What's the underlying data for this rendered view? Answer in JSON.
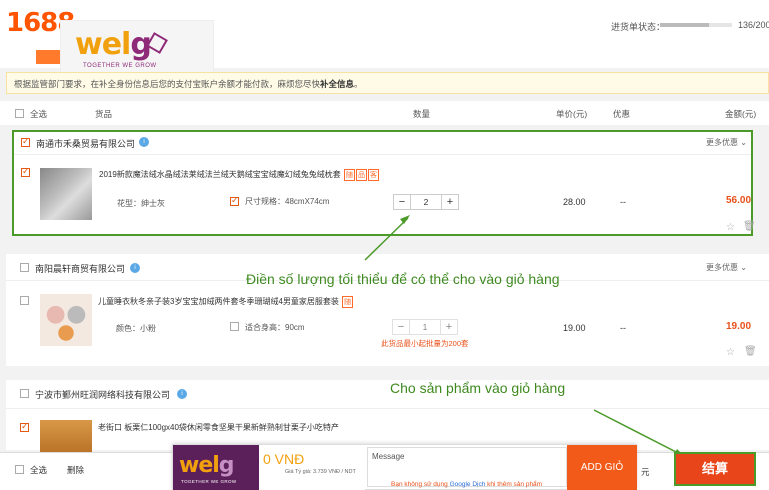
{
  "topbar": {
    "site_number": "1688",
    "status_label": "进货单状态：",
    "status_count": "136/200",
    "status_progress": 0.68
  },
  "logo": {
    "word_left": "wel",
    "word_right": "g",
    "tagline": "TOGETHER WE GROW"
  },
  "notice": {
    "text": "根据监管部门要求，在补全身份信息后您的支付宝账户余额才能付款，麻烦您尽快",
    "bold": "补全信息",
    "end": "。"
  },
  "header": {
    "select_all": "全选",
    "columns": {
      "goods": "货品",
      "quantity": "数量",
      "unit_price": "单价(元)",
      "discount": "优惠",
      "amount": "金额(元)"
    }
  },
  "shops": [
    {
      "name": "南通市禾桑贸易有限公司",
      "more": "更多优惠",
      "checked": true,
      "product": {
        "name": "2019新款魔法绒水晶绒法莱绒法兰绒天鹅绒宝宝绒魔幻绒兔兔绒枕套",
        "badges": [
          "随",
          "品",
          "客"
        ],
        "variant_label": "花型：",
        "variant_value": "绅士灰",
        "size_label": "尺寸规格：",
        "size_value": "48cmX74cm",
        "quantity": "2",
        "unit_price": "28.00",
        "discount": "--",
        "amount": "56.00"
      }
    },
    {
      "name": "南阳晨轩商贸有限公司",
      "more": "更多优惠",
      "checked": false,
      "product": {
        "name": "儿童睡衣秋冬亲子装3岁宝宝加绒两件套冬季珊瑚绒4男童家居服套装",
        "badges": [
          "随"
        ],
        "variant_label": "颜色：",
        "variant_value": "小粉",
        "size_label": "适合身高：",
        "size_value": "90cm",
        "quantity": "1",
        "unit_price": "19.00",
        "discount": "--",
        "amount": "19.00",
        "warning": "此货品最小起批量为200套"
      }
    },
    {
      "name": "宁波市鄞州旺润网络科技有限公司",
      "checked": true,
      "product": {
        "name": "老街口 板栗仁100gx40袋休闲零食坚果干果新鲜熟制甘栗子小吃特产"
      }
    }
  ],
  "annotations": {
    "min_qty": "Điền số lượng tối thiểu để có thể cho vào giỏ hàng",
    "add_to_cart": "Cho sản phẩm vào giỏ hàng"
  },
  "bottom": {
    "select_all": "全选",
    "delete": "删除",
    "yuan": "元",
    "pay": "结算"
  },
  "gt_bar": {
    "word_left": "wel",
    "word_right": "g",
    "tagline": "TOGETHER WE GROW",
    "price": "0 VNĐ",
    "rate": "Giá Tỷ giá: 3.739 VNĐ / NDT",
    "message_label": "Message",
    "add_button": "ADD GIỎ",
    "note_prefix": "Bạn không sử dụng",
    "note_link": "Google Dịch",
    "note_suffix": "khi thêm sản phẩm"
  },
  "colors": {
    "accent": "#ff5500",
    "highlight_green": "#4c9a2a",
    "pay_red": "#e8461a"
  },
  "icons": [
    "info-icon",
    "star-icon",
    "trash-icon",
    "chevron-down-icon"
  ]
}
